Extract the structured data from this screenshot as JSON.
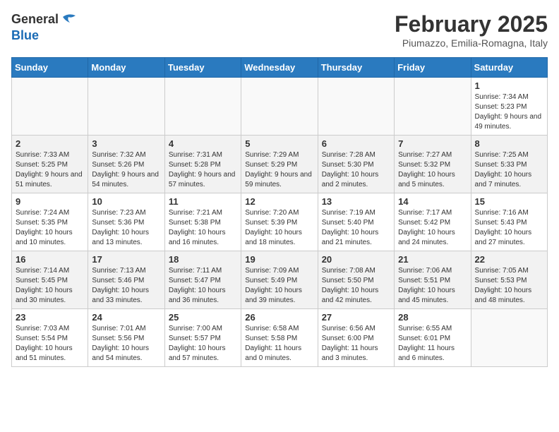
{
  "header": {
    "logo_general": "General",
    "logo_blue": "Blue",
    "month_title": "February 2025",
    "location": "Piumazzo, Emilia-Romagna, Italy"
  },
  "days_of_week": [
    "Sunday",
    "Monday",
    "Tuesday",
    "Wednesday",
    "Thursday",
    "Friday",
    "Saturday"
  ],
  "weeks": [
    [
      {
        "day": "",
        "info": ""
      },
      {
        "day": "",
        "info": ""
      },
      {
        "day": "",
        "info": ""
      },
      {
        "day": "",
        "info": ""
      },
      {
        "day": "",
        "info": ""
      },
      {
        "day": "",
        "info": ""
      },
      {
        "day": "1",
        "info": "Sunrise: 7:34 AM\nSunset: 5:23 PM\nDaylight: 9 hours and 49 minutes."
      }
    ],
    [
      {
        "day": "2",
        "info": "Sunrise: 7:33 AM\nSunset: 5:25 PM\nDaylight: 9 hours and 51 minutes."
      },
      {
        "day": "3",
        "info": "Sunrise: 7:32 AM\nSunset: 5:26 PM\nDaylight: 9 hours and 54 minutes."
      },
      {
        "day": "4",
        "info": "Sunrise: 7:31 AM\nSunset: 5:28 PM\nDaylight: 9 hours and 57 minutes."
      },
      {
        "day": "5",
        "info": "Sunrise: 7:29 AM\nSunset: 5:29 PM\nDaylight: 9 hours and 59 minutes."
      },
      {
        "day": "6",
        "info": "Sunrise: 7:28 AM\nSunset: 5:30 PM\nDaylight: 10 hours and 2 minutes."
      },
      {
        "day": "7",
        "info": "Sunrise: 7:27 AM\nSunset: 5:32 PM\nDaylight: 10 hours and 5 minutes."
      },
      {
        "day": "8",
        "info": "Sunrise: 7:25 AM\nSunset: 5:33 PM\nDaylight: 10 hours and 7 minutes."
      }
    ],
    [
      {
        "day": "9",
        "info": "Sunrise: 7:24 AM\nSunset: 5:35 PM\nDaylight: 10 hours and 10 minutes."
      },
      {
        "day": "10",
        "info": "Sunrise: 7:23 AM\nSunset: 5:36 PM\nDaylight: 10 hours and 13 minutes."
      },
      {
        "day": "11",
        "info": "Sunrise: 7:21 AM\nSunset: 5:38 PM\nDaylight: 10 hours and 16 minutes."
      },
      {
        "day": "12",
        "info": "Sunrise: 7:20 AM\nSunset: 5:39 PM\nDaylight: 10 hours and 18 minutes."
      },
      {
        "day": "13",
        "info": "Sunrise: 7:19 AM\nSunset: 5:40 PM\nDaylight: 10 hours and 21 minutes."
      },
      {
        "day": "14",
        "info": "Sunrise: 7:17 AM\nSunset: 5:42 PM\nDaylight: 10 hours and 24 minutes."
      },
      {
        "day": "15",
        "info": "Sunrise: 7:16 AM\nSunset: 5:43 PM\nDaylight: 10 hours and 27 minutes."
      }
    ],
    [
      {
        "day": "16",
        "info": "Sunrise: 7:14 AM\nSunset: 5:45 PM\nDaylight: 10 hours and 30 minutes."
      },
      {
        "day": "17",
        "info": "Sunrise: 7:13 AM\nSunset: 5:46 PM\nDaylight: 10 hours and 33 minutes."
      },
      {
        "day": "18",
        "info": "Sunrise: 7:11 AM\nSunset: 5:47 PM\nDaylight: 10 hours and 36 minutes."
      },
      {
        "day": "19",
        "info": "Sunrise: 7:09 AM\nSunset: 5:49 PM\nDaylight: 10 hours and 39 minutes."
      },
      {
        "day": "20",
        "info": "Sunrise: 7:08 AM\nSunset: 5:50 PM\nDaylight: 10 hours and 42 minutes."
      },
      {
        "day": "21",
        "info": "Sunrise: 7:06 AM\nSunset: 5:51 PM\nDaylight: 10 hours and 45 minutes."
      },
      {
        "day": "22",
        "info": "Sunrise: 7:05 AM\nSunset: 5:53 PM\nDaylight: 10 hours and 48 minutes."
      }
    ],
    [
      {
        "day": "23",
        "info": "Sunrise: 7:03 AM\nSunset: 5:54 PM\nDaylight: 10 hours and 51 minutes."
      },
      {
        "day": "24",
        "info": "Sunrise: 7:01 AM\nSunset: 5:56 PM\nDaylight: 10 hours and 54 minutes."
      },
      {
        "day": "25",
        "info": "Sunrise: 7:00 AM\nSunset: 5:57 PM\nDaylight: 10 hours and 57 minutes."
      },
      {
        "day": "26",
        "info": "Sunrise: 6:58 AM\nSunset: 5:58 PM\nDaylight: 11 hours and 0 minutes."
      },
      {
        "day": "27",
        "info": "Sunrise: 6:56 AM\nSunset: 6:00 PM\nDaylight: 11 hours and 3 minutes."
      },
      {
        "day": "28",
        "info": "Sunrise: 6:55 AM\nSunset: 6:01 PM\nDaylight: 11 hours and 6 minutes."
      },
      {
        "day": "",
        "info": ""
      }
    ]
  ]
}
